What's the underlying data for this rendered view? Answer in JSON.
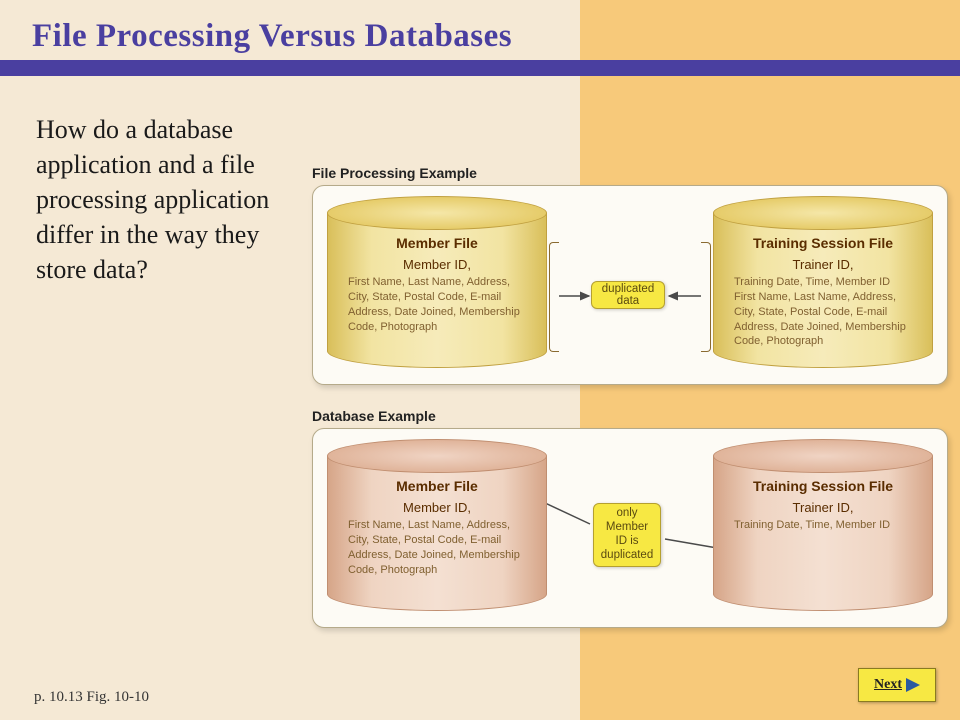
{
  "title": "File Processing Versus Databases",
  "question": "How do a database application and a file processing application differ in the way they store data?",
  "examples": {
    "file_processing": {
      "label": "File Processing Example",
      "left_file": {
        "name": "Member File",
        "key": "Member ID,",
        "fields": "First Name, Last Name, Address, City, State, Postal Code, E-mail Address, Date Joined, Membership Code, Photograph"
      },
      "right_file": {
        "name": "Training Session File",
        "key": "Trainer ID,",
        "fields": "Training Date, Time, Member ID First Name, Last Name, Address, City, State, Postal Code, E-mail Address, Date Joined, Membership Code, Photograph"
      },
      "center_label": "duplicated data"
    },
    "database": {
      "label": "Database Example",
      "left_file": {
        "name": "Member File",
        "key": "Member ID,",
        "fields": "First Name, Last Name, Address, City, State, Postal Code, E-mail Address, Date Joined, Membership Code, Photograph"
      },
      "right_file": {
        "name": "Training Session File",
        "key": "Trainer ID,",
        "fields": "Training Date, Time, Member ID"
      },
      "center_label": "only Member ID is duplicated"
    }
  },
  "footer": "p. 10.13 Fig. 10-10",
  "next_label": "Next",
  "colors": {
    "title": "#4a3fa0",
    "accent_bg": "#f7c97a",
    "page_bg": "#f5e9d5",
    "tag_bg": "#f7e843"
  }
}
